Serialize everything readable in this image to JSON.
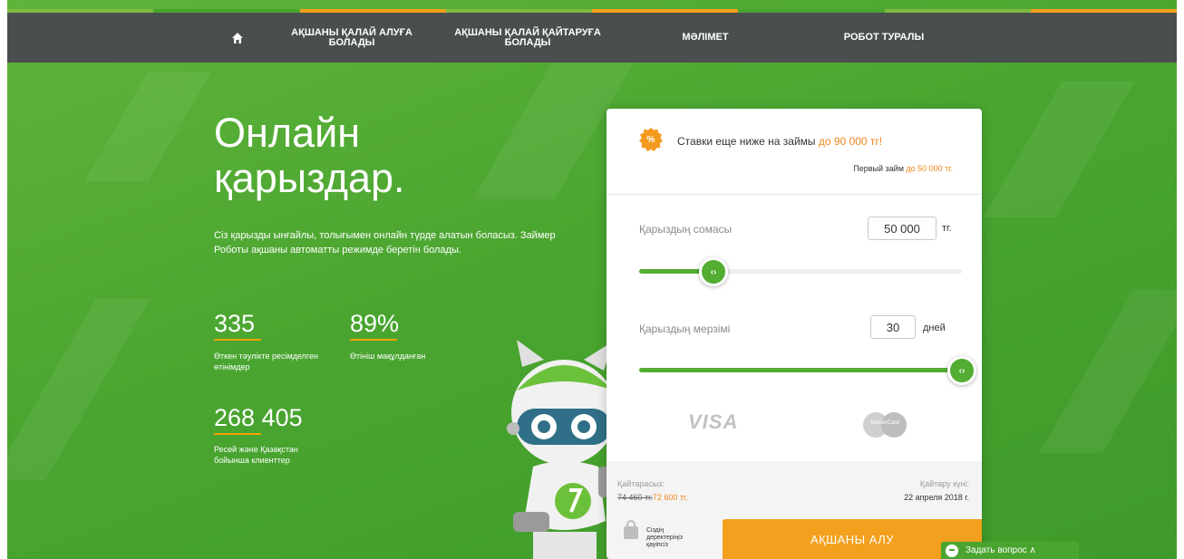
{
  "nav": {
    "items": [
      {
        "label": "АҚШАНЫ ҚАЛАЙ АЛУҒА БОЛАДЫ"
      },
      {
        "label": "АҚШАНЫ ҚАЛАЙ ҚАЙТАРУҒА БОЛАДЫ"
      },
      {
        "label": "МӘЛІМЕТ"
      },
      {
        "label": "РОБОТ ТУРАЛЫ"
      }
    ],
    "home_icon": "home-icon"
  },
  "hero": {
    "title": "Онлайн қарыздар.",
    "description": "Сіз қарызды ынғайлы, толығымен онлайн түрде алатын боласыз. Займер Роботы ақшаны автоматты режимде беретін болады."
  },
  "stats": [
    {
      "value": "335",
      "label": "Өткен тәуліктe ресімделген өтінімдер"
    },
    {
      "value": "89%",
      "label": "Өтініш мақұлданған"
    },
    {
      "value": "268 405",
      "label": "Ресей және Қазақстан бойынша клиенттер"
    }
  ],
  "calculator": {
    "promo_badge": "%",
    "promo_text": "Ставки еще ниже на займы ",
    "promo_amount": "до 90 000 тг!",
    "promo_sub": "Первый займ ",
    "promo_sub_amount": "до 50 000 тг.",
    "amount": {
      "label": "Қарыздың сомасы",
      "value": "50 000",
      "unit": "тг.",
      "slider_fraction": 0.23
    },
    "term": {
      "label": "Қарыздың мерзімі",
      "value": "30",
      "unit": "дней",
      "slider_fraction": 1.0
    },
    "slider_knob_glyph": "‹›",
    "payment_logos": {
      "visa": "VISA",
      "mastercard": "MasterCard"
    },
    "summary": {
      "return_label": "Қайтарасыз:",
      "old_price": "74 460 тг.",
      "new_price": "72 600 тг.",
      "date_label": "Қайтару күні:",
      "date_value": "22 апреля 2018 г."
    },
    "secure_text": "Сіздің деректеріңіз қауіпсіз",
    "cta_label": "АҚШАНЫ АЛУ"
  },
  "chat": {
    "label": "Задать вопрос ∧"
  },
  "colors": {
    "brand_green": "#4aa530",
    "accent_orange": "#f2a01d",
    "nav_bg": "#4a4e4f"
  }
}
